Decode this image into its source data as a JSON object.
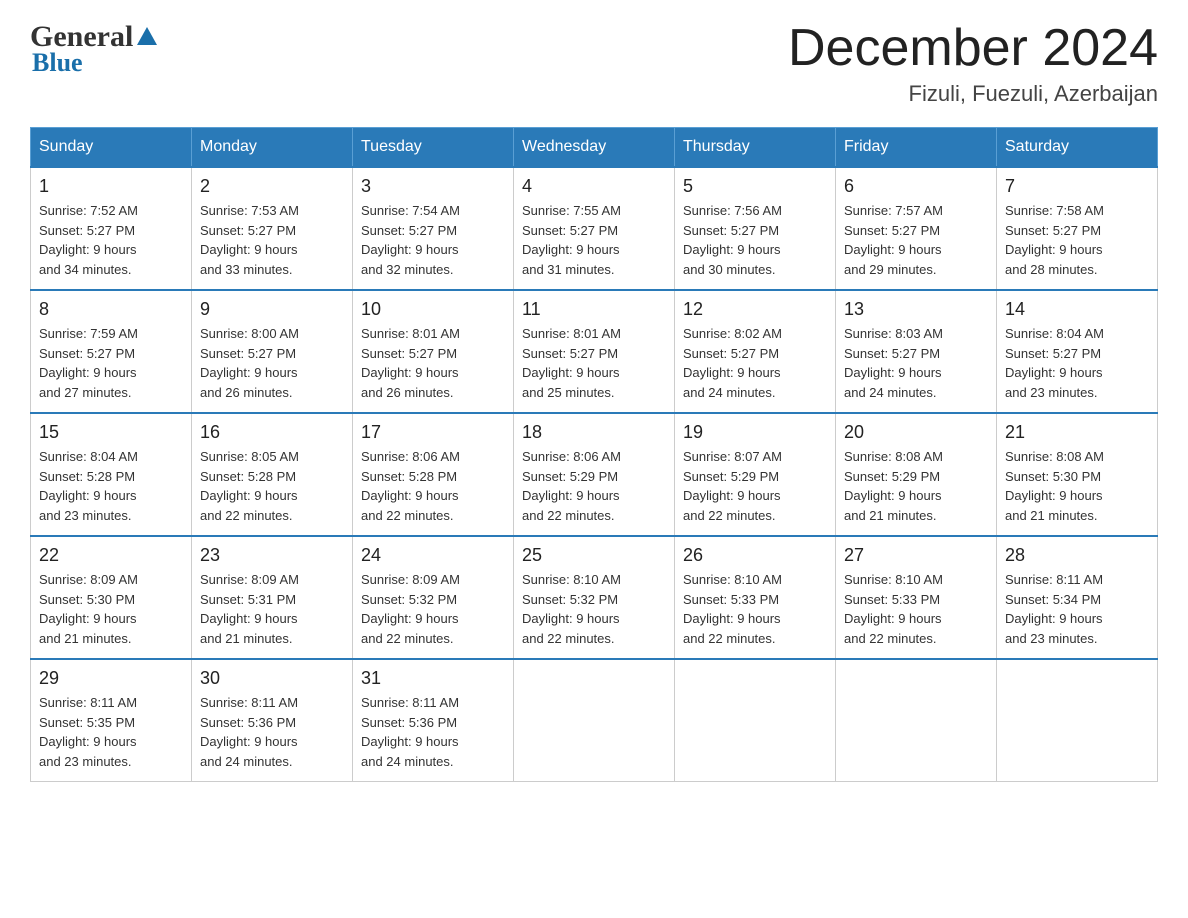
{
  "header": {
    "logo_general": "General",
    "logo_blue": "Blue",
    "month_year": "December 2024",
    "location": "Fizuli, Fuezuli, Azerbaijan"
  },
  "days_of_week": [
    "Sunday",
    "Monday",
    "Tuesday",
    "Wednesday",
    "Thursday",
    "Friday",
    "Saturday"
  ],
  "weeks": [
    [
      {
        "day": "1",
        "sunrise": "7:52 AM",
        "sunset": "5:27 PM",
        "daylight": "9 hours and 34 minutes."
      },
      {
        "day": "2",
        "sunrise": "7:53 AM",
        "sunset": "5:27 PM",
        "daylight": "9 hours and 33 minutes."
      },
      {
        "day": "3",
        "sunrise": "7:54 AM",
        "sunset": "5:27 PM",
        "daylight": "9 hours and 32 minutes."
      },
      {
        "day": "4",
        "sunrise": "7:55 AM",
        "sunset": "5:27 PM",
        "daylight": "9 hours and 31 minutes."
      },
      {
        "day": "5",
        "sunrise": "7:56 AM",
        "sunset": "5:27 PM",
        "daylight": "9 hours and 30 minutes."
      },
      {
        "day": "6",
        "sunrise": "7:57 AM",
        "sunset": "5:27 PM",
        "daylight": "9 hours and 29 minutes."
      },
      {
        "day": "7",
        "sunrise": "7:58 AM",
        "sunset": "5:27 PM",
        "daylight": "9 hours and 28 minutes."
      }
    ],
    [
      {
        "day": "8",
        "sunrise": "7:59 AM",
        "sunset": "5:27 PM",
        "daylight": "9 hours and 27 minutes."
      },
      {
        "day": "9",
        "sunrise": "8:00 AM",
        "sunset": "5:27 PM",
        "daylight": "9 hours and 26 minutes."
      },
      {
        "day": "10",
        "sunrise": "8:01 AM",
        "sunset": "5:27 PM",
        "daylight": "9 hours and 26 minutes."
      },
      {
        "day": "11",
        "sunrise": "8:01 AM",
        "sunset": "5:27 PM",
        "daylight": "9 hours and 25 minutes."
      },
      {
        "day": "12",
        "sunrise": "8:02 AM",
        "sunset": "5:27 PM",
        "daylight": "9 hours and 24 minutes."
      },
      {
        "day": "13",
        "sunrise": "8:03 AM",
        "sunset": "5:27 PM",
        "daylight": "9 hours and 24 minutes."
      },
      {
        "day": "14",
        "sunrise": "8:04 AM",
        "sunset": "5:27 PM",
        "daylight": "9 hours and 23 minutes."
      }
    ],
    [
      {
        "day": "15",
        "sunrise": "8:04 AM",
        "sunset": "5:28 PM",
        "daylight": "9 hours and 23 minutes."
      },
      {
        "day": "16",
        "sunrise": "8:05 AM",
        "sunset": "5:28 PM",
        "daylight": "9 hours and 22 minutes."
      },
      {
        "day": "17",
        "sunrise": "8:06 AM",
        "sunset": "5:28 PM",
        "daylight": "9 hours and 22 minutes."
      },
      {
        "day": "18",
        "sunrise": "8:06 AM",
        "sunset": "5:29 PM",
        "daylight": "9 hours and 22 minutes."
      },
      {
        "day": "19",
        "sunrise": "8:07 AM",
        "sunset": "5:29 PM",
        "daylight": "9 hours and 22 minutes."
      },
      {
        "day": "20",
        "sunrise": "8:08 AM",
        "sunset": "5:29 PM",
        "daylight": "9 hours and 21 minutes."
      },
      {
        "day": "21",
        "sunrise": "8:08 AM",
        "sunset": "5:30 PM",
        "daylight": "9 hours and 21 minutes."
      }
    ],
    [
      {
        "day": "22",
        "sunrise": "8:09 AM",
        "sunset": "5:30 PM",
        "daylight": "9 hours and 21 minutes."
      },
      {
        "day": "23",
        "sunrise": "8:09 AM",
        "sunset": "5:31 PM",
        "daylight": "9 hours and 21 minutes."
      },
      {
        "day": "24",
        "sunrise": "8:09 AM",
        "sunset": "5:32 PM",
        "daylight": "9 hours and 22 minutes."
      },
      {
        "day": "25",
        "sunrise": "8:10 AM",
        "sunset": "5:32 PM",
        "daylight": "9 hours and 22 minutes."
      },
      {
        "day": "26",
        "sunrise": "8:10 AM",
        "sunset": "5:33 PM",
        "daylight": "9 hours and 22 minutes."
      },
      {
        "day": "27",
        "sunrise": "8:10 AM",
        "sunset": "5:33 PM",
        "daylight": "9 hours and 22 minutes."
      },
      {
        "day": "28",
        "sunrise": "8:11 AM",
        "sunset": "5:34 PM",
        "daylight": "9 hours and 23 minutes."
      }
    ],
    [
      {
        "day": "29",
        "sunrise": "8:11 AM",
        "sunset": "5:35 PM",
        "daylight": "9 hours and 23 minutes."
      },
      {
        "day": "30",
        "sunrise": "8:11 AM",
        "sunset": "5:36 PM",
        "daylight": "9 hours and 24 minutes."
      },
      {
        "day": "31",
        "sunrise": "8:11 AM",
        "sunset": "5:36 PM",
        "daylight": "9 hours and 24 minutes."
      },
      null,
      null,
      null,
      null
    ]
  ],
  "labels": {
    "sunrise": "Sunrise:",
    "sunset": "Sunset:",
    "daylight": "Daylight:"
  }
}
